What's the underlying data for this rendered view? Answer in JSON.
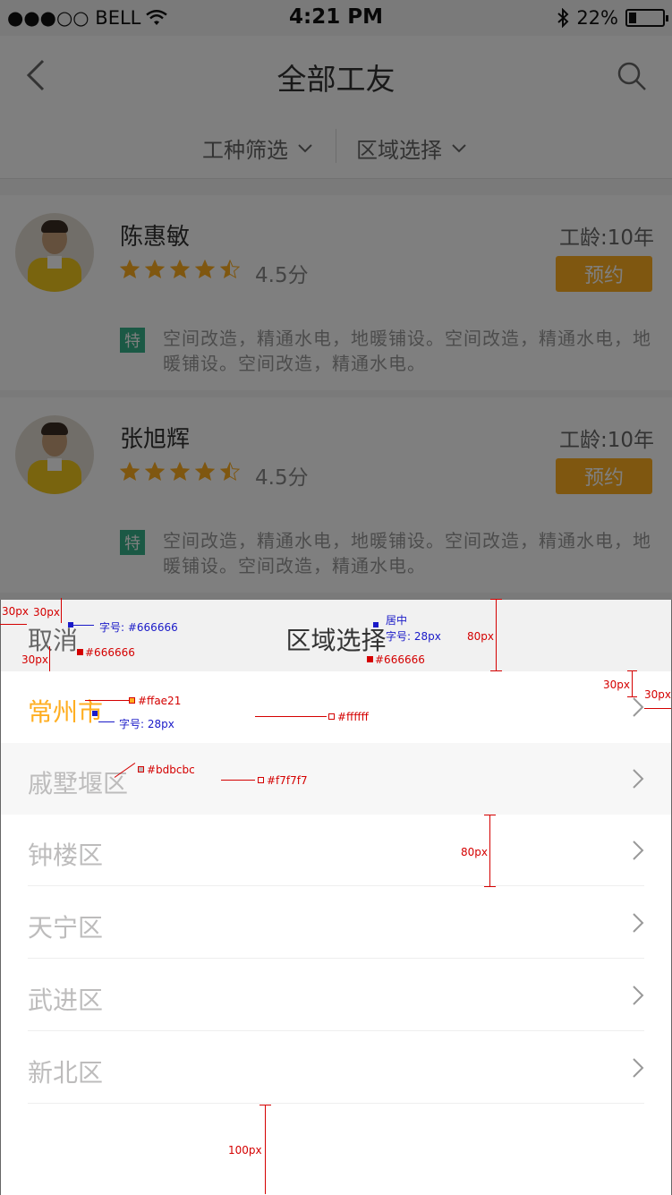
{
  "status_bar": {
    "carrier": "●●●○○ BELL",
    "time": "4:21 PM",
    "battery": "22%",
    "battery_level": 0.22
  },
  "nav": {
    "title": "全部工友"
  },
  "filters": [
    {
      "label": "工种筛选"
    },
    {
      "label": "区域选择"
    }
  ],
  "workers": [
    {
      "name": "陈惠敏",
      "experience": "工龄:10年",
      "rating": 4.5,
      "score": "4.5分",
      "book_label": "预约",
      "tag": "特",
      "desc": "空间改造，精通水电，地暖铺设。空间改造，精通水电，地暖铺设。空间改造，精通水电。"
    },
    {
      "name": "张旭辉",
      "experience": "工龄:10年",
      "rating": 4.5,
      "score": "4.5分",
      "book_label": "预约",
      "tag": "特",
      "desc": "空间改造，精通水电，地暖铺设。空间改造，精通水电，地暖铺设。空间改造，精通水电。"
    }
  ],
  "sheet": {
    "cancel": "取消",
    "title": "区域选择",
    "items": [
      {
        "label": "常州市"
      },
      {
        "label": "戚墅堰区"
      },
      {
        "label": "钟楼区"
      },
      {
        "label": "天宁区"
      },
      {
        "label": "武进区"
      },
      {
        "label": "新北区"
      }
    ]
  },
  "annotations": {
    "m30_a": "30px",
    "m30_b": "30px",
    "m30_c": "30px",
    "m30_d": "30px",
    "m30_e": "30px",
    "font_cancel": "字号: #666666",
    "color_cancel": "#666666",
    "center": "居中",
    "font_title": "字号: 28px",
    "color_title": "#666666",
    "h80_header": "80px",
    "color_active": "#ffae21",
    "font_active": "字号: 28px",
    "color_white": "#ffffff",
    "color_label": "#bdbcbc",
    "color_shaded": "#f7f7f7",
    "h80_row": "80px",
    "h100_bottom": "100px"
  },
  "colors": {
    "accent": "#ffae21",
    "label": "#bdbcbc",
    "title": "#666666",
    "tag": "#37b28a",
    "shaded": "#f7f7f7"
  }
}
